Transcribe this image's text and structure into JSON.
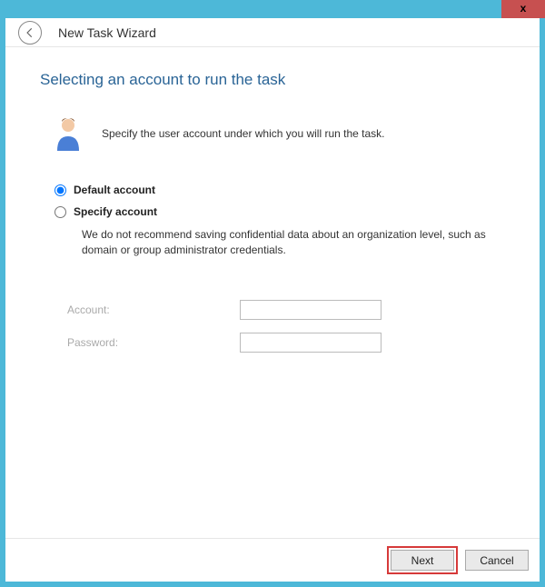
{
  "window": {
    "title": "New Task Wizard",
    "close_label": "x"
  },
  "page": {
    "heading": "Selecting an account to run the task",
    "intro": "Specify the user account under which you will run the task."
  },
  "options": {
    "default_label": "Default account",
    "specify_label": "Specify account",
    "selected": "default",
    "note": "We do not recommend saving confidential data about an organization level, such as domain or group administrator credentials."
  },
  "form": {
    "account_label": "Account:",
    "password_label": "Password:",
    "account_value": "",
    "password_value": ""
  },
  "footer": {
    "next_label": "Next",
    "cancel_label": "Cancel"
  }
}
